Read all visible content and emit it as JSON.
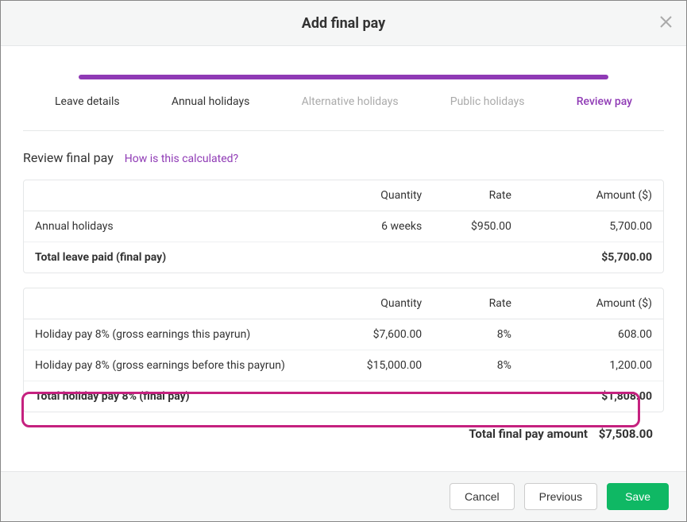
{
  "modal": {
    "title": "Add final pay"
  },
  "stepper": {
    "steps": [
      {
        "label": "Leave details",
        "state": "done"
      },
      {
        "label": "Annual holidays",
        "state": "done"
      },
      {
        "label": "Alternative holidays",
        "state": "disabled"
      },
      {
        "label": "Public holidays",
        "state": "disabled"
      },
      {
        "label": "Review pay",
        "state": "active"
      }
    ]
  },
  "section": {
    "title": "Review final pay",
    "help_link": "How is this calculated?"
  },
  "table_headers": {
    "description": "",
    "quantity": "Quantity",
    "rate": "Rate",
    "amount": "Amount ($)"
  },
  "table1": {
    "rows": [
      {
        "desc": "Annual holidays",
        "qty": "6 weeks",
        "rate": "$950.00",
        "amount": "5,700.00"
      }
    ],
    "total": {
      "desc": "Total leave paid (final pay)",
      "amount": "$5,700.00"
    }
  },
  "table2": {
    "rows": [
      {
        "desc": "Holiday pay 8% (gross earnings this payrun)",
        "qty": "$7,600.00",
        "rate": "8%",
        "amount": "608.00"
      },
      {
        "desc": "Holiday pay 8% (gross earnings before this payrun)",
        "qty": "$15,000.00",
        "rate": "8%",
        "amount": "1,200.00"
      }
    ],
    "total": {
      "desc": "Total holiday pay 8% (final pay)",
      "amount": "$1,808.00"
    }
  },
  "grand_total": {
    "label": "Total final pay amount",
    "amount": "$7,508.00"
  },
  "footer": {
    "cancel": "Cancel",
    "previous": "Previous",
    "save": "Save"
  }
}
